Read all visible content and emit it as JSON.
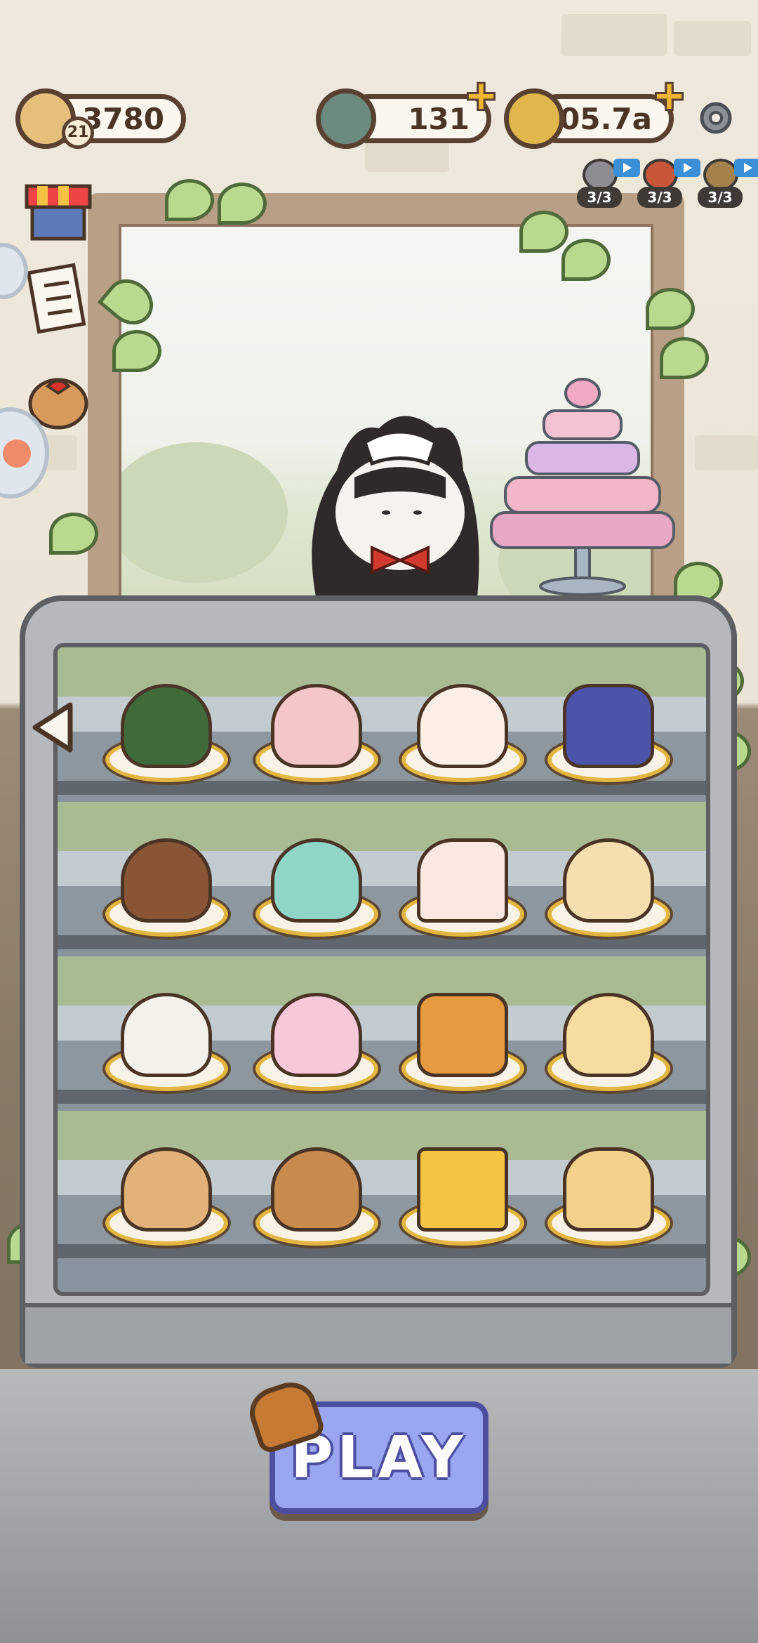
{
  "currency": {
    "bread": {
      "value": "3780",
      "level": "21"
    },
    "gems": {
      "value": "131"
    },
    "coins": {
      "value": "105.7a"
    }
  },
  "boosters": [
    {
      "name": "gear-booster",
      "count": "3/3"
    },
    {
      "name": "fire-booster",
      "count": "3/3"
    },
    {
      "name": "spoon-booster",
      "count": "3/3"
    }
  ],
  "case": {
    "shelves": [
      [
        "melon-bread",
        "berry-mousse-cake",
        "cat-mochi",
        "blueberry-mousse"
      ],
      [
        "orange-muffin",
        "mint-cupcake",
        "strawberry-shortcake",
        "cream-puff"
      ],
      [
        "cappuccino",
        "cat-cupcake",
        "fruit-tart",
        "pudding"
      ],
      [
        "bear-bread",
        "cream-scone",
        "cheese",
        "egg-tart"
      ]
    ]
  },
  "play_button": {
    "label": "PLAY"
  },
  "colors": {
    "accent": "#9aa6f2",
    "outline": "#5a4030",
    "plate_rim": "#e2b640",
    "leaf": "#b8d98e"
  }
}
